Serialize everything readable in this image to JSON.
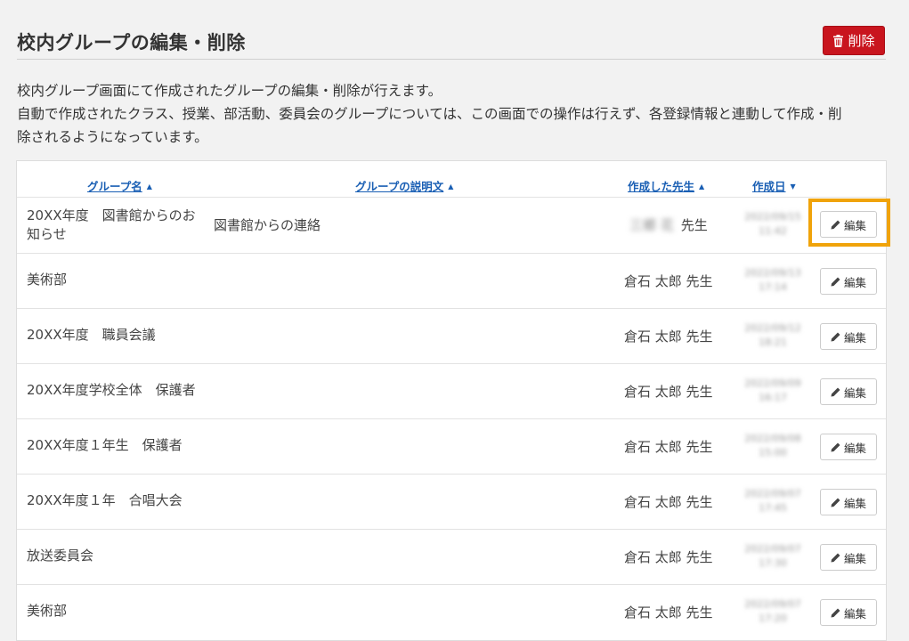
{
  "header": {
    "title": "校内グループの編集・削除",
    "delete_label": "削除",
    "accent_color": "#c9151e"
  },
  "description": {
    "line1": "校内グループ画面にて作成されたグループの編集・削除が行えます。",
    "line2": "自動で作成されたクラス、授業、部活動、委員会のグループについては、この画面での操作は行えず、各登録情報と連動して作成・削",
    "line3": "除されるようになっています。"
  },
  "table": {
    "columns": {
      "name": "グループ名",
      "desc": "グループの説明文",
      "teacher": "作成した先生",
      "date": "作成日"
    },
    "sort_icons": {
      "name": "▲",
      "desc": "▲",
      "teacher": "▲",
      "date": "▼"
    },
    "edit_label": "編集",
    "rows": [
      {
        "name": "20XX年度　図書館からのお知らせ",
        "desc": "図書館からの連絡",
        "teacher_blurred": "三郷 花",
        "teacher_suffix": "先生",
        "date_line1": "2022/09/15",
        "date_line2": "11:42"
      },
      {
        "name": "美術部",
        "desc": "",
        "teacher": "倉石 太郎 先生",
        "date_line1": "2022/09/13",
        "date_line2": "17:14"
      },
      {
        "name": "20XX年度　職員会議",
        "desc": "",
        "teacher": "倉石 太郎 先生",
        "date_line1": "2022/09/12",
        "date_line2": "18:21"
      },
      {
        "name": "20XX年度学校全体　保護者",
        "desc": "",
        "teacher": "倉石 太郎 先生",
        "date_line1": "2022/09/09",
        "date_line2": "16:17"
      },
      {
        "name": "20XX年度１年生　保護者",
        "desc": "",
        "teacher": "倉石 太郎 先生",
        "date_line1": "2022/09/08",
        "date_line2": "15:00"
      },
      {
        "name": "20XX年度１年　合唱大会",
        "desc": "",
        "teacher": "倉石 太郎 先生",
        "date_line1": "2022/09/07",
        "date_line2": "17:45"
      },
      {
        "name": "放送委員会",
        "desc": "",
        "teacher": "倉石 太郎 先生",
        "date_line1": "2022/09/07",
        "date_line2": "17:30"
      },
      {
        "name": "美術部",
        "desc": "",
        "teacher": "倉石 太郎 先生",
        "date_line1": "2022/09/07",
        "date_line2": "17:20"
      }
    ]
  },
  "highlight_color": "#f0a30a"
}
